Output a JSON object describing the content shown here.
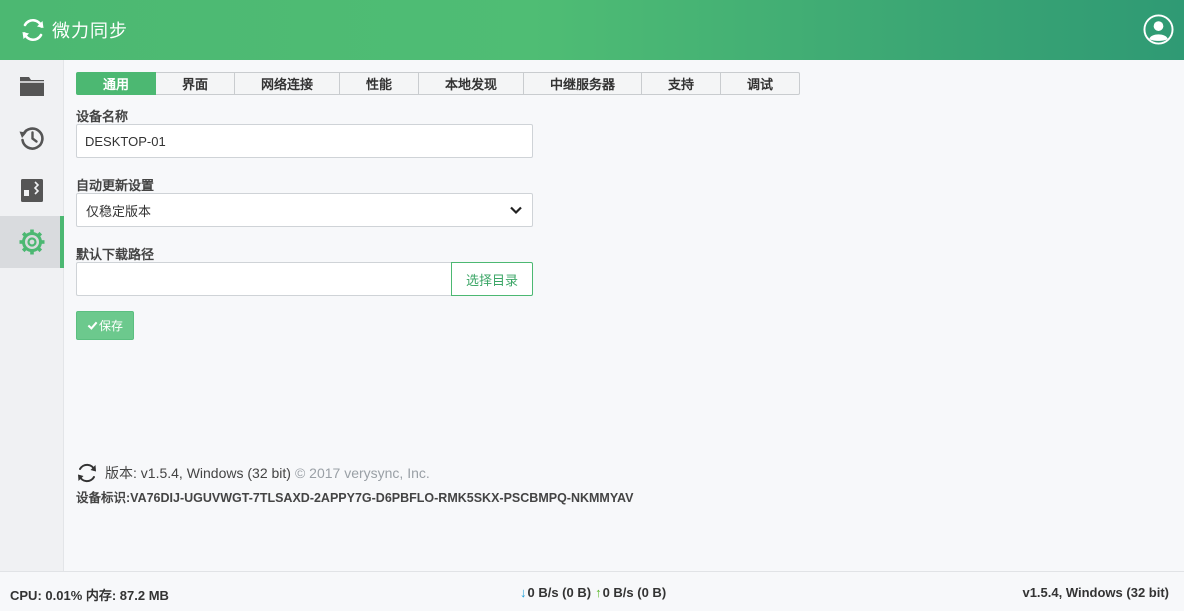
{
  "app": {
    "title": "微力同步"
  },
  "colors": {
    "brand": "#4cb872",
    "header_dark": "#2f9a74",
    "download_arrow": "#1a9fd9",
    "upload_arrow": "#5cb82a"
  },
  "sidebar": {
    "items": [
      {
        "icon": "folder-icon",
        "active": false
      },
      {
        "icon": "history-icon",
        "active": false
      },
      {
        "icon": "device-icon",
        "active": false
      },
      {
        "icon": "gear-icon",
        "active": true
      }
    ]
  },
  "tabs": [
    {
      "label": "通用",
      "active": true
    },
    {
      "label": "界面",
      "active": false
    },
    {
      "label": "网络连接",
      "active": false
    },
    {
      "label": "性能",
      "active": false
    },
    {
      "label": "本地发现",
      "active": false
    },
    {
      "label": "中继服务器",
      "active": false
    },
    {
      "label": "支持",
      "active": false
    },
    {
      "label": "调试",
      "active": false
    }
  ],
  "form": {
    "device_name_label": "设备名称",
    "device_name_value": "DESKTOP-01",
    "auto_update_label": "自动更新设置",
    "auto_update_value": "仅稳定版本",
    "download_path_label": "默认下载路径",
    "download_path_value": "",
    "browse_label": "选择目录",
    "save_label": "保存"
  },
  "about": {
    "version_text": "版本: v1.5.4, Windows (32 bit)",
    "copyright": "© 2017 verysync, Inc.",
    "device_id": "设备标识:VA76DIJ-UGUVWGT-7TLSAXD-2APPY7G-D6PBFLO-RMK5SKX-PSCBMPQ-NKMMYAV"
  },
  "footer": {
    "cpu_mem": "CPU: 0.01% 内存: 87.2 MB",
    "down_arrow": "↓",
    "down_rate": "0 B/s (0 B)",
    "up_arrow": "↑",
    "up_rate": "0 B/s (0 B)",
    "version": "v1.5.4, Windows (32 bit)"
  }
}
